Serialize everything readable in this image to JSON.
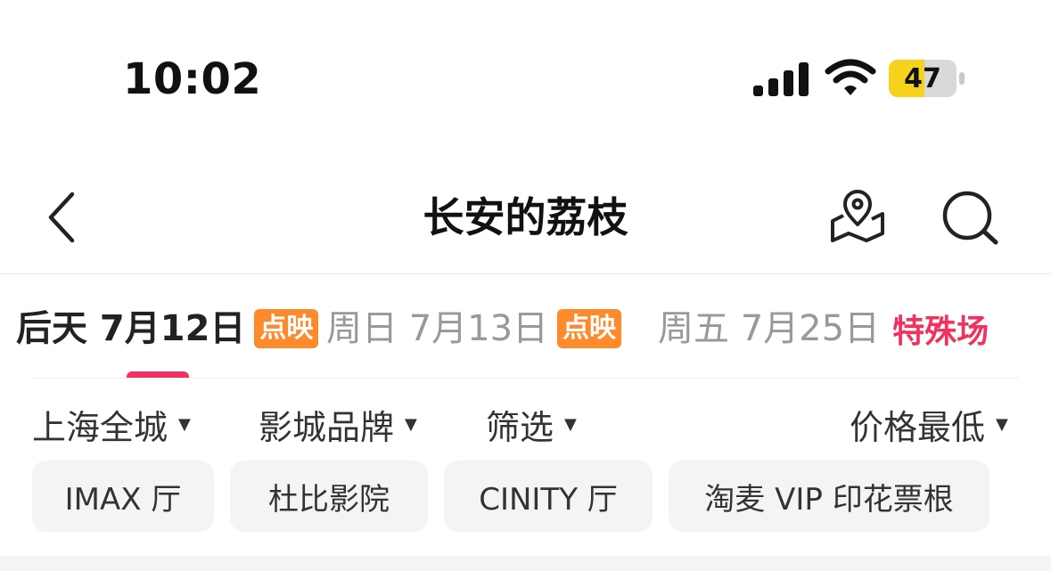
{
  "status_bar": {
    "time": "10:02",
    "battery_level": "47",
    "battery_color": "#f7d21c"
  },
  "nav": {
    "title": "长安的荔枝"
  },
  "date_tabs": [
    {
      "label": "后天 7月12日",
      "tag": "点映",
      "tag_type": "badge",
      "active": true
    },
    {
      "label": "周日 7月13日",
      "tag": "点映",
      "tag_type": "badge",
      "active": false
    },
    {
      "label": "周五 7月25日",
      "tag": "特殊场",
      "tag_type": "text",
      "active": false
    }
  ],
  "filters": [
    {
      "label": "上海全城"
    },
    {
      "label": "影城品牌"
    },
    {
      "label": "筛选"
    },
    {
      "label": "价格最低"
    }
  ],
  "chips": [
    {
      "label": "IMAX 厅"
    },
    {
      "label": "杜比影院"
    },
    {
      "label": "CINITY 厅"
    },
    {
      "label": "淘麦 VIP 印花票根"
    }
  ],
  "colors": {
    "accent": "#f2315f",
    "badge": "#ff8a2b",
    "chip_bg": "#f3f4f6"
  }
}
